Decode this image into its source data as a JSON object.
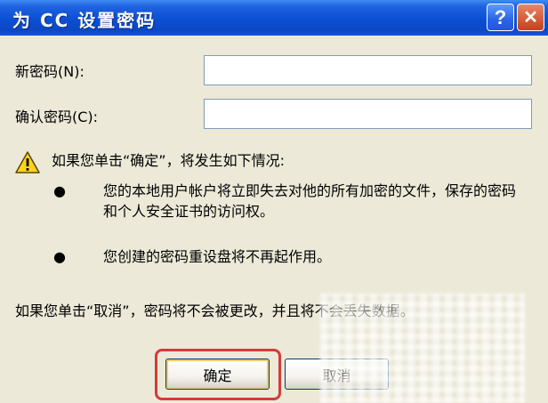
{
  "window": {
    "title": "为 CC 设置密码"
  },
  "titlebar": {
    "help_label": "?",
    "close_label": "✕"
  },
  "form": {
    "new_password_label": "新密码(N):",
    "new_password_value": "",
    "confirm_password_label": "确认密码(C):",
    "confirm_password_value": ""
  },
  "warning": {
    "icon": "warning-triangle-icon",
    "intro": "如果您单击“确定”，将发生如下情况:",
    "bullets": [
      "您的本地用户帐户将立即失去对他的所有加密的文件，保存的密码和个人安全证书的访问权。",
      "您创建的密码重设盘将不再起作用。"
    ],
    "cancel_note": "如果您单击“取消”，密码将不会被更改，并且将不会丢失数据。"
  },
  "buttons": {
    "ok_label": "确定",
    "cancel_label": "取消"
  },
  "colors": {
    "titlebar": "#0a4fd3",
    "highlight": "#d63a3a",
    "dialog_bg": "#ece9d8"
  }
}
